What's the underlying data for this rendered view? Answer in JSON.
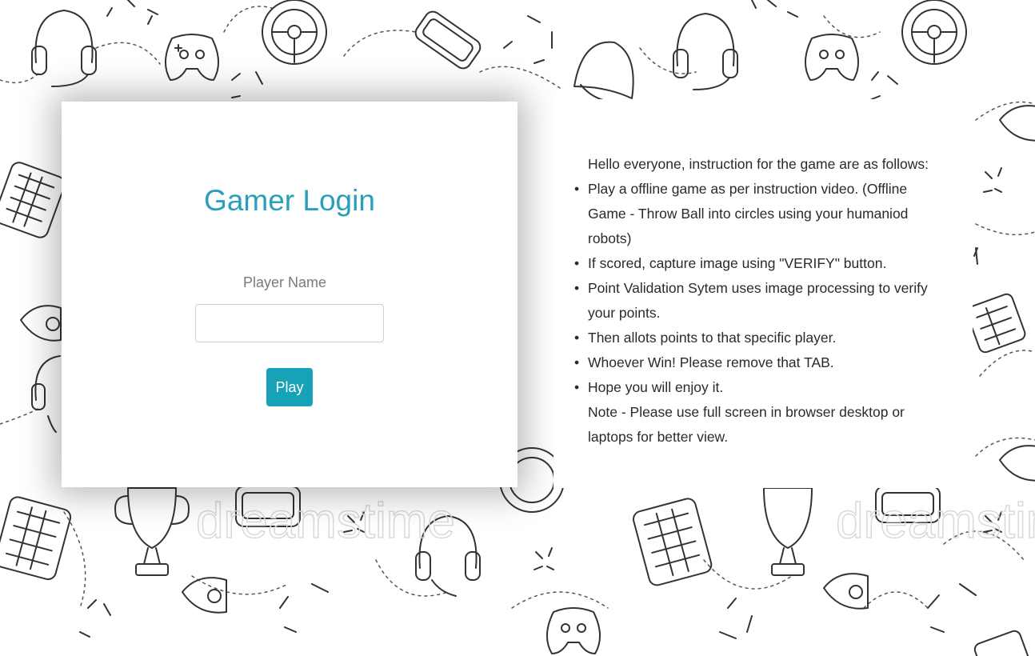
{
  "background": {
    "watermark_text": "dreamstime",
    "icons": [
      "headset-icon",
      "gamepad-icon",
      "steering-wheel-icon",
      "vr-headset-icon",
      "keyboard-icon",
      "trophy-icon",
      "mouse-icon",
      "focus-frame-icon",
      "cap-icon",
      "sparkle-icon"
    ]
  },
  "login": {
    "title": "Gamer Login",
    "player_label": "Player Name",
    "player_value": "",
    "player_placeholder": "",
    "play_label": "Play"
  },
  "instructions": {
    "intro": "Hello everyone, instruction for the game are as follows:",
    "items": [
      "Play a offline game as per instruction video. (Offline Game - Throw Ball into circles using your humaniod robots)",
      "If scored, capture image using \"VERIFY\" button.",
      "Point Validation Sytem uses image processing to verify your points.",
      "Then allots points to that specific player.",
      "Whoever Win! Please remove that TAB.",
      "Hope you will enjoy it."
    ],
    "bullet": "•",
    "note": "Note - Please use full screen in browser desktop or laptops for better view."
  },
  "colors": {
    "title": "#2a9fbc",
    "button": "#17a2b8",
    "text": "#2a2a2a",
    "label": "#7a7a7a"
  }
}
